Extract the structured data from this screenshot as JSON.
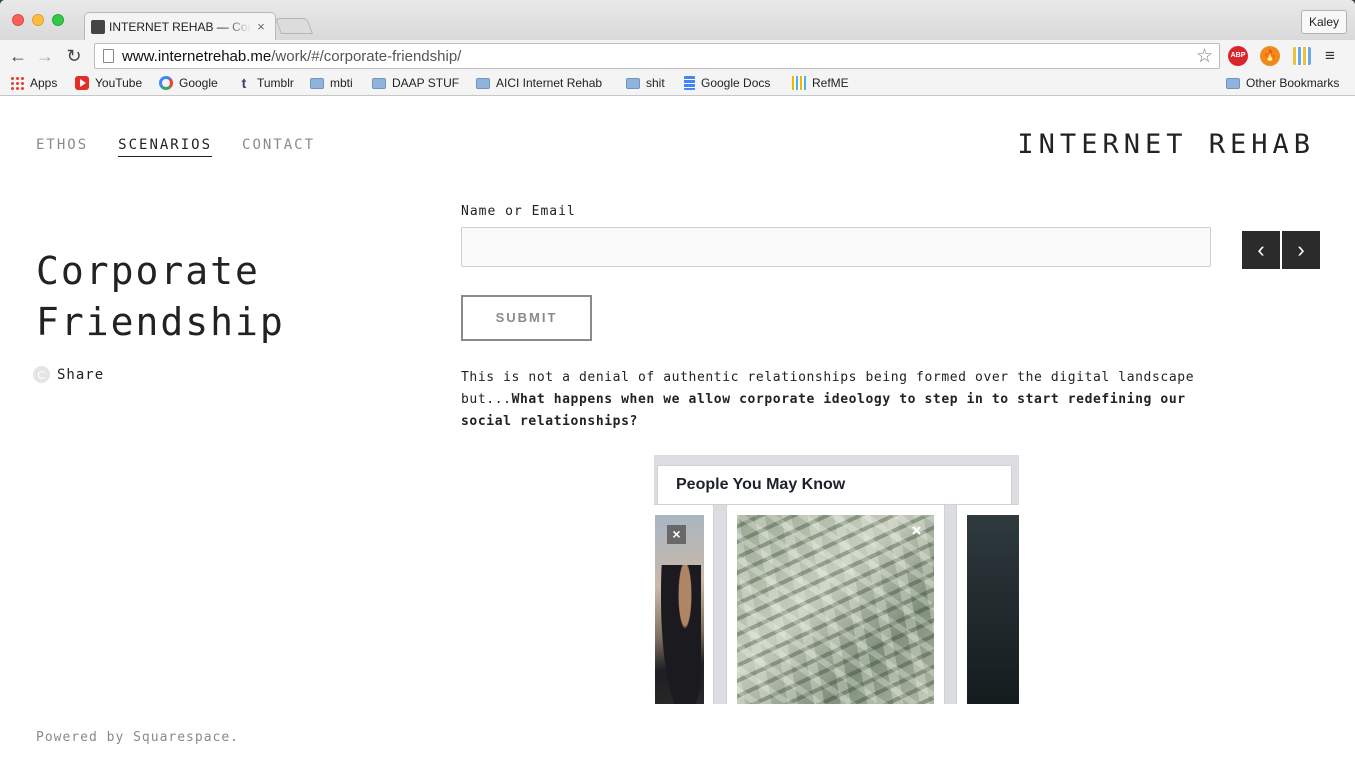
{
  "browser": {
    "tab_title": "INTERNET REHAB — Corporate Friendship",
    "tab_close": "×",
    "profile_name": "Kaley",
    "url_host": "www.internetrehab.me",
    "url_path": "/work/#/corporate-friendship/",
    "nav_icons": {
      "back": "←",
      "forward": "→",
      "reload": "↻",
      "star": "☆",
      "menu": "≡"
    },
    "extensions": [
      {
        "name": "adblock-plus",
        "label": "ABP",
        "color": "#d8262c"
      },
      {
        "name": "fire",
        "label": "🔥",
        "color": "#f08a1c"
      },
      {
        "name": "bars",
        "label": ""
      }
    ],
    "bookmarks": [
      {
        "label": "Apps",
        "icon": "apps-icon"
      },
      {
        "label": "YouTube",
        "icon": "youtube-icon"
      },
      {
        "label": "Google",
        "icon": "google-icon"
      },
      {
        "label": "Tumblr",
        "icon": "tumblr-icon"
      },
      {
        "label": "mbti",
        "icon": "folder-icon"
      },
      {
        "label": "DAAP STUF",
        "icon": "folder-icon"
      },
      {
        "label": "AICI Internet Rehab",
        "icon": "folder-icon"
      },
      {
        "label": "shit",
        "icon": "folder-icon"
      },
      {
        "label": "Google Docs",
        "icon": "docs-icon"
      },
      {
        "label": "RefME",
        "icon": "refme-icon"
      },
      {
        "label": "Other Bookmarks",
        "icon": "folder-icon"
      }
    ]
  },
  "site": {
    "nav": [
      {
        "label": "ETHOS",
        "active": false
      },
      {
        "label": "SCENARIOS",
        "active": true
      },
      {
        "label": "CONTACT",
        "active": false
      }
    ],
    "title": "INTERNET REHAB",
    "footer": "Powered by Squarespace."
  },
  "post": {
    "title_line1": "Corporate",
    "title_line2": "Friendship",
    "share_label": "Share",
    "form": {
      "field_label": "Name or Email",
      "field_value": "",
      "submit_label": "SUBMIT"
    },
    "arrows": {
      "prev": "‹",
      "next": "›"
    },
    "body_plain": "This is not a denial of authentic relationships being formed over the digital landscape but...",
    "body_bold": "What happens when we allow corporate ideology to step in to start redefining our social relationships?",
    "image": {
      "heading": "People You May Know",
      "close_glyph": "×"
    }
  },
  "colors": {
    "accent_dark": "#2b2b2b",
    "nav_muted": "#8a8a8a",
    "text": "#222222"
  }
}
